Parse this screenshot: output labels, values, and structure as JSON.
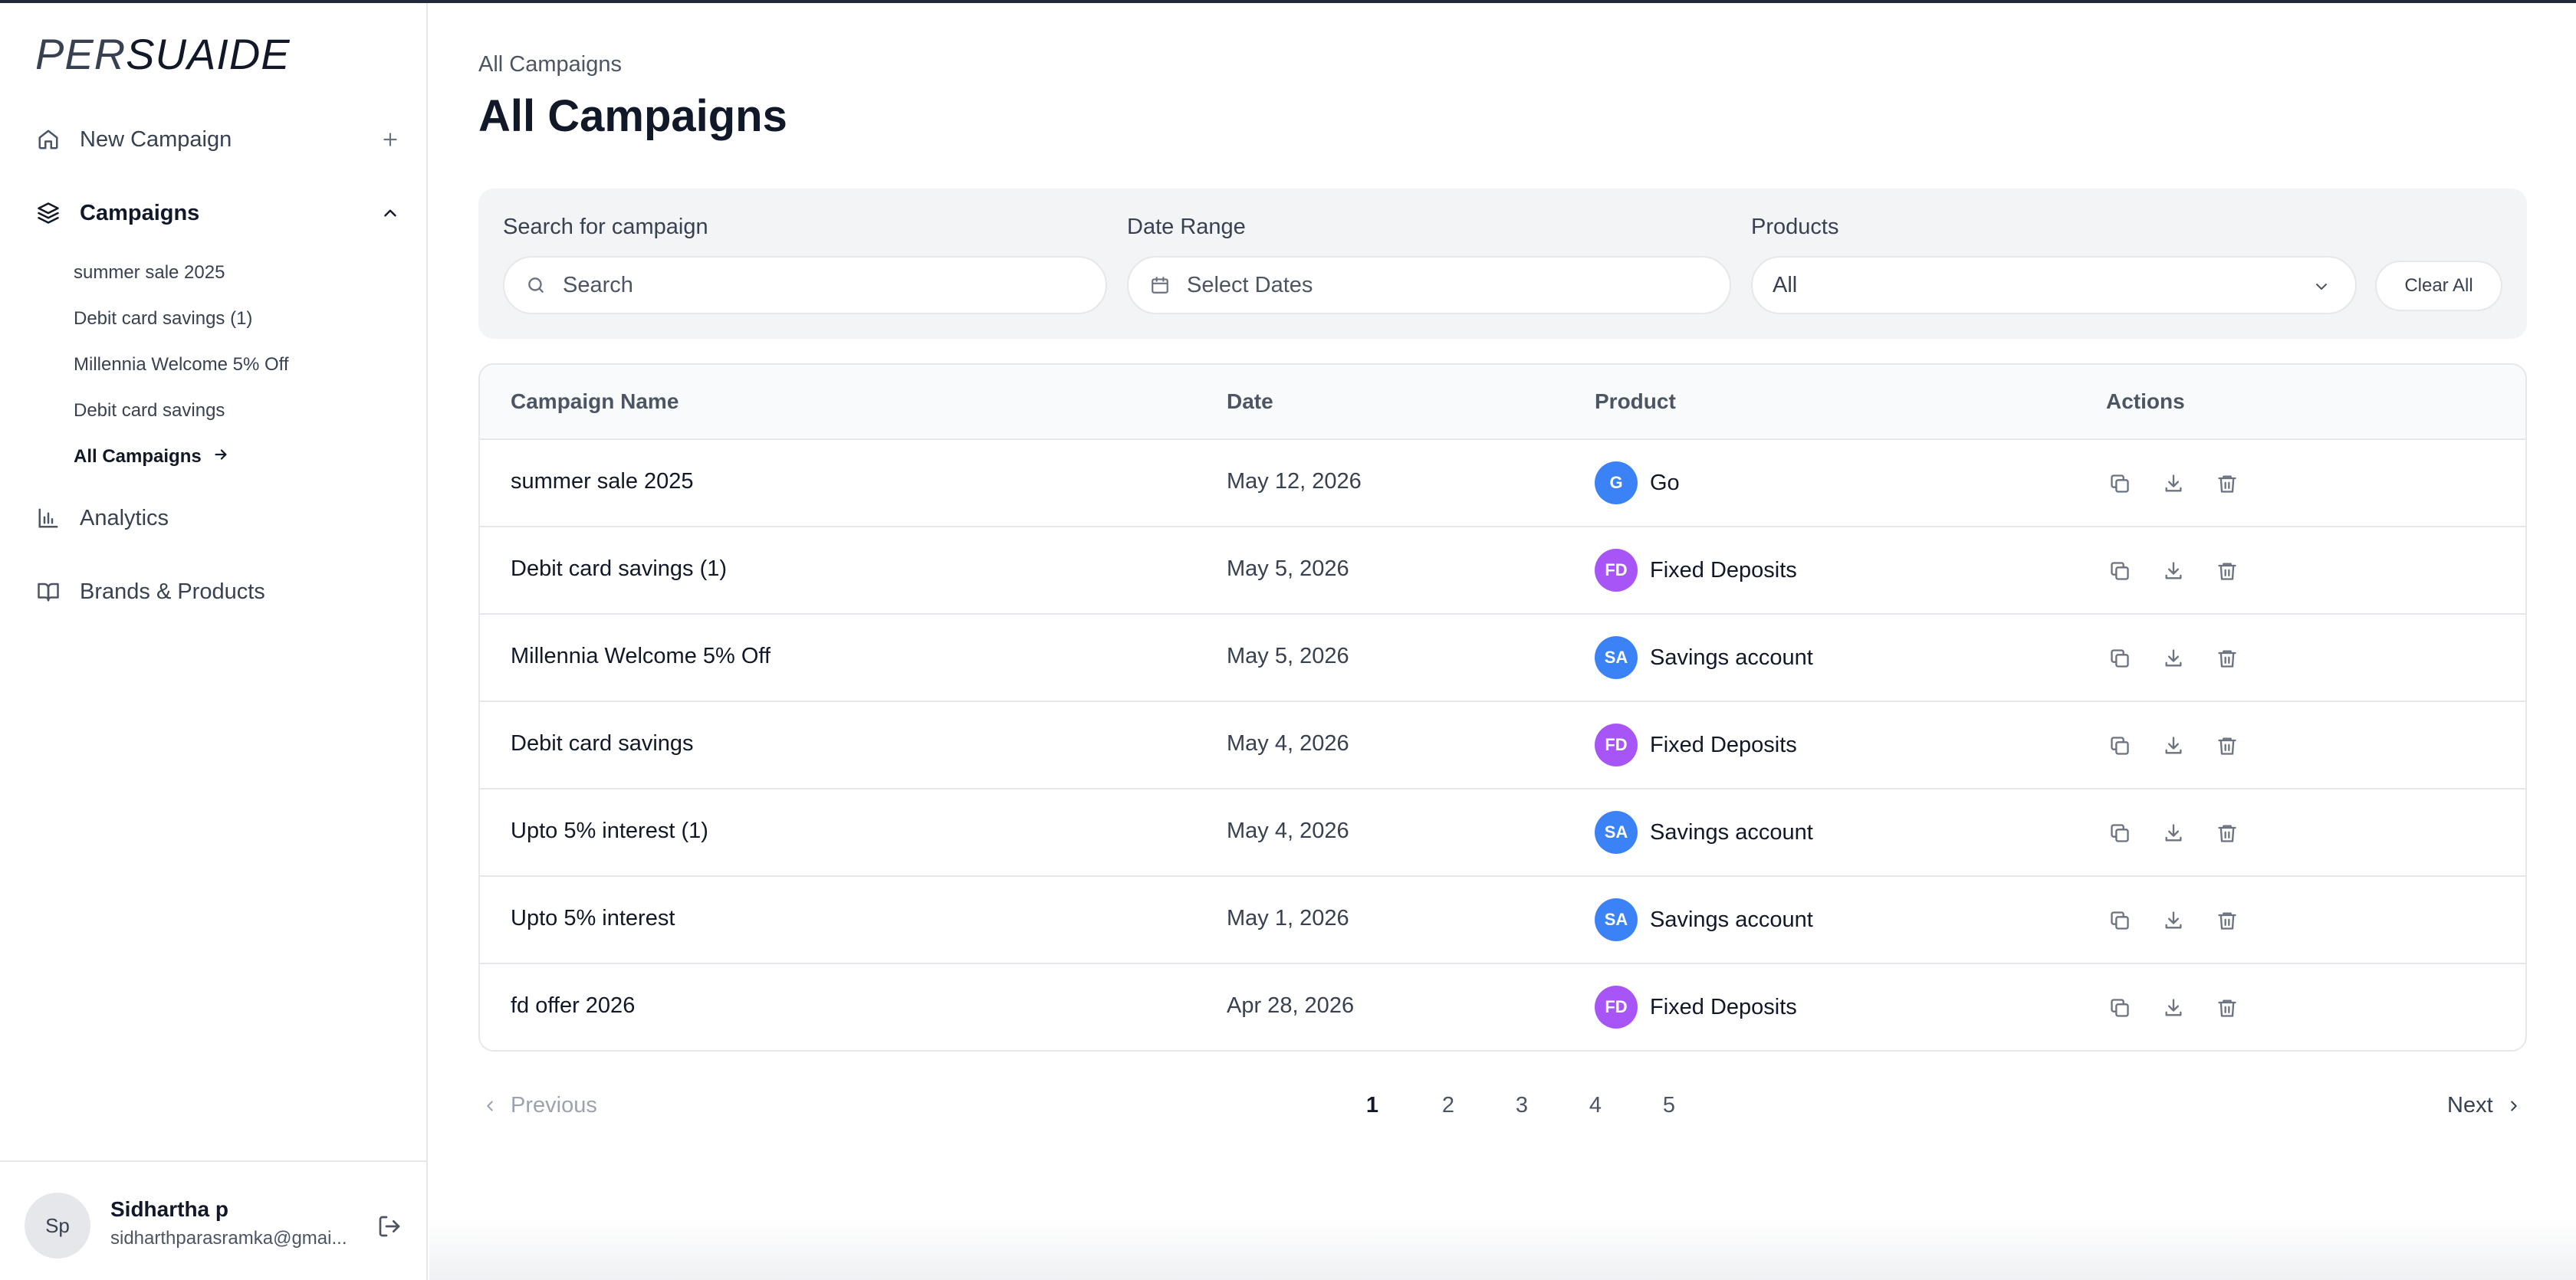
{
  "app": {
    "logo_part1": "PER",
    "logo_part2": "SUAIDE"
  },
  "sidebar": {
    "new_campaign": "New Campaign",
    "campaigns": "Campaigns",
    "sub_items": [
      "summer sale 2025",
      "Debit card savings (1)",
      "Millennia Welcome 5% Off",
      "Debit card savings"
    ],
    "all_campaigns": "All Campaigns",
    "analytics": "Analytics",
    "brands_products": "Brands & Products"
  },
  "user": {
    "initials": "Sp",
    "name": "Sidhartha p",
    "email": "sidharthparasramka@gmai..."
  },
  "header": {
    "breadcrumb": "All Campaigns",
    "title": "All Campaigns"
  },
  "filters": {
    "search_label": "Search for campaign",
    "search_placeholder": "Search",
    "date_label": "Date Range",
    "date_placeholder": "Select Dates",
    "products_label": "Products",
    "products_value": "All",
    "clear_all": "Clear All"
  },
  "table": {
    "columns": [
      "Campaign Name",
      "Date",
      "Product",
      "Actions"
    ],
    "rows": [
      {
        "name": "summer sale 2025",
        "date": "May 12, 2026",
        "badge": "G",
        "badge_color": "#3b82f6",
        "product": "Go"
      },
      {
        "name": "Debit card savings (1)",
        "date": "May 5, 2026",
        "badge": "FD",
        "badge_color": "#a855f7",
        "product": "Fixed Deposits"
      },
      {
        "name": "Millennia Welcome 5% Off",
        "date": "May 5, 2026",
        "badge": "SA",
        "badge_color": "#3b82f6",
        "product": "Savings account"
      },
      {
        "name": "Debit card savings",
        "date": "May 4, 2026",
        "badge": "FD",
        "badge_color": "#a855f7",
        "product": "Fixed Deposits"
      },
      {
        "name": "Upto 5% interest (1)",
        "date": "May 4, 2026",
        "badge": "SA",
        "badge_color": "#3b82f6",
        "product": "Savings account"
      },
      {
        "name": "Upto 5% interest",
        "date": "May 1, 2026",
        "badge": "SA",
        "badge_color": "#3b82f6",
        "product": "Savings account"
      },
      {
        "name": "fd offer 2026",
        "date": "Apr 28, 2026",
        "badge": "FD",
        "badge_color": "#a855f7",
        "product": "Fixed Deposits"
      }
    ]
  },
  "pagination": {
    "previous": "Previous",
    "next": "Next",
    "pages": [
      "1",
      "2",
      "3",
      "4",
      "5"
    ],
    "current": "1"
  }
}
